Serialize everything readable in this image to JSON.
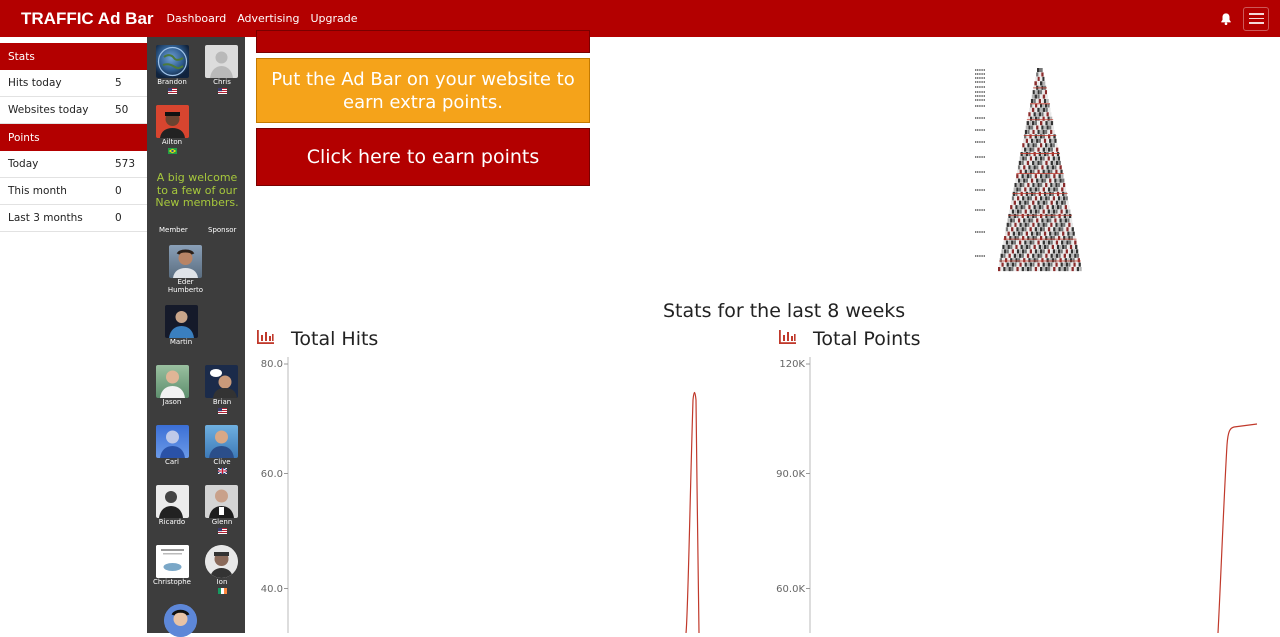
{
  "navbar": {
    "brand": "TRAFFIC Ad Bar",
    "links": [
      "Dashboard",
      "Advertising",
      "Upgrade"
    ]
  },
  "stats": {
    "stats_header": "Stats",
    "rows_a": [
      {
        "label": "Hits today",
        "value": "5"
      },
      {
        "label": "Websites today",
        "value": "50"
      }
    ],
    "points_header": "Points",
    "rows_b": [
      {
        "label": "Today",
        "value": "573"
      },
      {
        "label": "This month",
        "value": "0"
      },
      {
        "label": "Last 3 months",
        "value": "0"
      }
    ]
  },
  "members": {
    "top": [
      {
        "name": "Brandon",
        "flag": "us"
      },
      {
        "name": "Chris",
        "flag": "us"
      },
      {
        "name": "Ailton",
        "flag": "br"
      }
    ],
    "welcome": "A big welcome to a few of our New members.",
    "col_member": "Member",
    "col_sponsor": "Sponsor",
    "new_members": [
      {
        "name": "Eder Humberto"
      },
      {
        "name": "Martin"
      },
      {
        "name": "Jason"
      },
      {
        "name": "Brian",
        "flag": "us"
      },
      {
        "name": "Carl"
      },
      {
        "name": "Clive",
        "flag": "gb"
      },
      {
        "name": "Ricardo"
      },
      {
        "name": "Glenn",
        "flag": "us"
      },
      {
        "name": "Christophe"
      },
      {
        "name": "Ion",
        "flag": "ie"
      }
    ]
  },
  "main": {
    "adbar_button": "Put the Ad Bar on your website to earn extra points.",
    "earn_button": "Click here to earn points",
    "stats_title": "Stats for the last 8 weeks"
  },
  "chart_data": [
    {
      "type": "line",
      "title": "Total Hits",
      "yticks": [
        "80.0",
        "60.0",
        "40.0"
      ],
      "color": "#c0392b"
    },
    {
      "type": "line",
      "title": "Total Points",
      "yticks": [
        "120K",
        "90.0K",
        "60.0K"
      ],
      "color": "#c0392b"
    }
  ],
  "colors": {
    "brand_red": "#b30000",
    "orange": "#f5a31a",
    "sidebar_dark": "#3d3d3d",
    "welcome_green": "#a6c83c"
  }
}
